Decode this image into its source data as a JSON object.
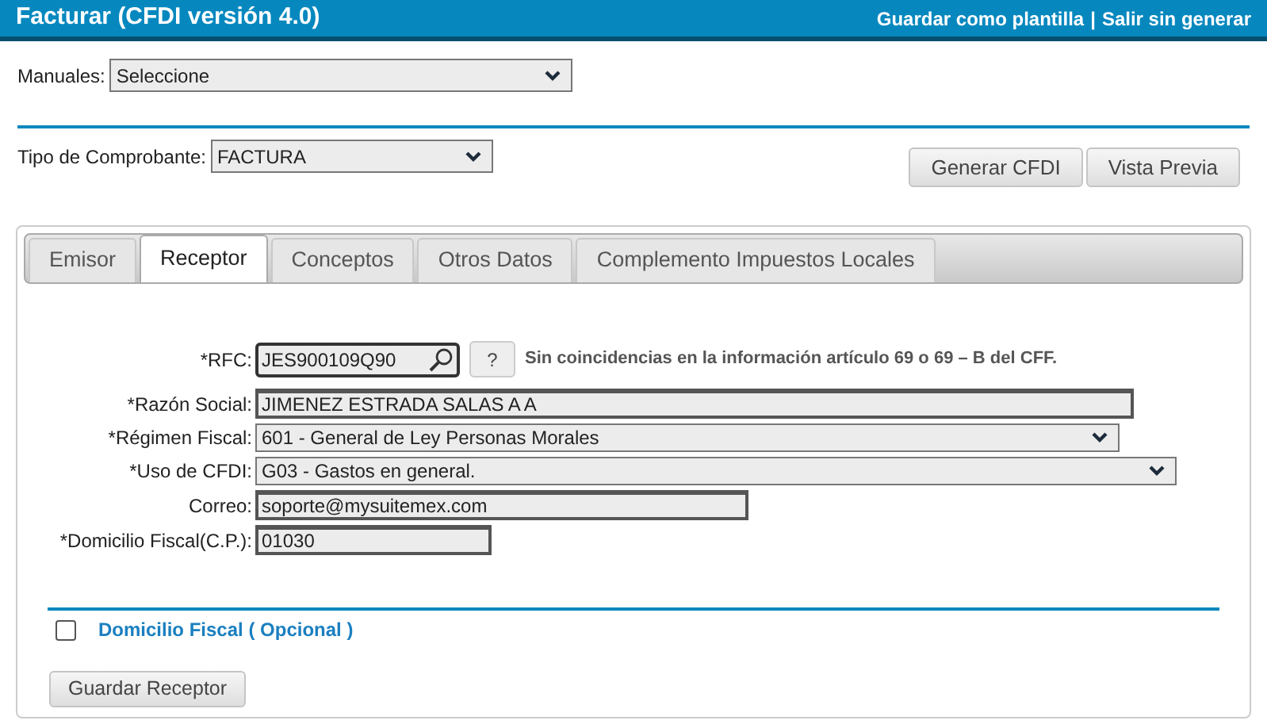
{
  "header": {
    "title": "Facturar (CFDI versión 4.0)",
    "links": [
      "Guardar como plantilla",
      "Salir sin generar"
    ],
    "separator": "|"
  },
  "manuales": {
    "label": "Manuales:",
    "value": "Seleccione"
  },
  "tipo": {
    "label": "Tipo de Comprobante:",
    "value": "FACTURA"
  },
  "actions": [
    "Generar CFDI",
    "Vista Previa"
  ],
  "tabs": [
    {
      "label": "Emisor",
      "selected": false
    },
    {
      "label": "Receptor",
      "selected": true
    },
    {
      "label": "Conceptos",
      "selected": false
    },
    {
      "label": "Otros Datos",
      "selected": false
    },
    {
      "label": "Complemento Impuestos Locales",
      "selected": false
    }
  ],
  "fields": [
    {
      "kind": "search",
      "label": "*RFC:",
      "value": "JES900109Q90",
      "help": "?",
      "message": "Sin coincidencias en la información artículo 69 o 69 – B del CFF."
    },
    {
      "kind": "text",
      "label": "*Razón Social:",
      "value": "JIMENEZ ESTRADA SALAS A A"
    },
    {
      "kind": "select",
      "label": "*Régimen Fiscal:",
      "value": "601 - General de Ley Personas Morales"
    },
    {
      "kind": "select",
      "label": "*Uso de CFDI:",
      "value": "G03 - Gastos en general."
    },
    {
      "kind": "text",
      "label": "Correo:",
      "value": "soporte@mysuitemex.com"
    },
    {
      "kind": "text",
      "label": "*Domicilio Fiscal(C.P.):",
      "value": "01030"
    }
  ],
  "domicilio": {
    "label": "Domicilio Fiscal ( Opcional )",
    "checked": false
  },
  "save": "Guardar Receptor"
}
